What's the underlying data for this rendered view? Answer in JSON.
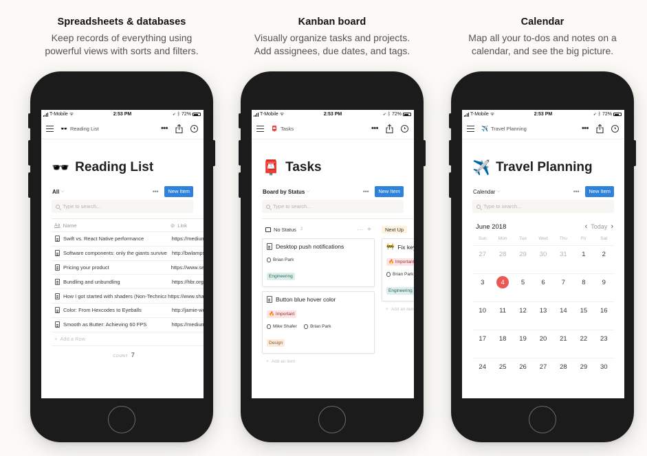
{
  "features": [
    {
      "title": "Spreadsheets & databases",
      "line1": "Keep records of everything using",
      "line2": "powerful views with sorts and filters."
    },
    {
      "title": "Kanban board",
      "line1": "Visually organize tasks and projects.",
      "line2": "Add assignees, due dates, and tags."
    },
    {
      "title": "Calendar",
      "line1": "Map all your to-dos and notes on a",
      "line2": "calendar, and see the big picture."
    }
  ],
  "status_bar": {
    "carrier": "T-Mobile",
    "time": "2:53 PM",
    "battery": "72%",
    "battery_level": 0.72
  },
  "common": {
    "new_item_label": "New Item",
    "search_placeholder": "Type to search...",
    "more_dots": "•••",
    "chevron_down": "⌵"
  },
  "reading_list": {
    "emoji": "🕶️",
    "title": "Reading List",
    "view_name": "All",
    "columns": {
      "name": "Name",
      "link": "Link"
    },
    "rows": [
      {
        "name": "Swift vs. React Native performance",
        "link": "https://medium.com"
      },
      {
        "name": "Software components: only the giants survive",
        "link": "http://bwlampson"
      },
      {
        "name": "Pricing your product",
        "link": "https://www.sequoia"
      },
      {
        "name": "Bundling and unbundling",
        "link": "https://hbr.org"
      },
      {
        "name": "How I got started with shaders (Non-Technical)",
        "link": "https://www.shadertoy"
      },
      {
        "name": "Color: From Hexcodes to Eyeballs",
        "link": "http://jamie-wong"
      },
      {
        "name": "Smooth as Butter: Achieving 60 FPS",
        "link": "https://medium.com"
      }
    ],
    "add_row_label": "Add a Row",
    "count_label": "COUNT",
    "count_value": "7"
  },
  "tasks": {
    "emoji": "📮",
    "title": "Tasks",
    "view_name": "Board by Status",
    "columns": [
      {
        "name": "No Status",
        "count": "2",
        "cards": [
          {
            "title": "Desktop push notifications",
            "tags_before": [],
            "people": [
              "Brian Park"
            ],
            "tags_after": [
              {
                "label": "Engineering",
                "kind": "eng"
              }
            ]
          },
          {
            "title": "Button blue hover color",
            "tags_before": [
              {
                "label": "🔥 Important",
                "kind": "imp"
              }
            ],
            "people": [
              "Mike Shafer",
              "Brian Park"
            ],
            "tags_after": [
              {
                "label": "Design",
                "kind": "design"
              }
            ]
          }
        ],
        "add_label": "Add an item"
      },
      {
        "name": "Next Up",
        "cards": [
          {
            "emoji": "🚧",
            "title": "Fix keyboard",
            "tags_before": [
              {
                "label": "🔥 Important",
                "kind": "imp"
              }
            ],
            "people": [
              "Brian Park"
            ],
            "tags_after": [
              {
                "label": "Engineering",
                "kind": "eng"
              }
            ]
          }
        ],
        "add_label": "Add an item"
      }
    ]
  },
  "travel": {
    "emoji": "✈️",
    "title": "Travel Planning",
    "view_name": "Calendar",
    "month": "June 2018",
    "today_label": "Today",
    "weekdays": [
      "Sun",
      "Mon",
      "Tue",
      "Wed",
      "Thu",
      "Fri",
      "Sat"
    ],
    "weeks": [
      [
        "27",
        "28",
        "29",
        "30",
        "31",
        "1",
        "2"
      ],
      [
        "3",
        "4",
        "5",
        "6",
        "7",
        "8",
        "9"
      ],
      [
        "10",
        "11",
        "12",
        "13",
        "14",
        "15",
        "16"
      ],
      [
        "17",
        "18",
        "19",
        "20",
        "21",
        "22",
        "23"
      ],
      [
        "24",
        "25",
        "26",
        "27",
        "28",
        "29",
        "30"
      ]
    ],
    "muted_days_first_week": 5,
    "today": "4",
    "today_color": "#eb5757"
  },
  "colors": {
    "accent": "#2e82dc",
    "phone_body": "#1b1b1b",
    "background": "#fbfaf7"
  }
}
